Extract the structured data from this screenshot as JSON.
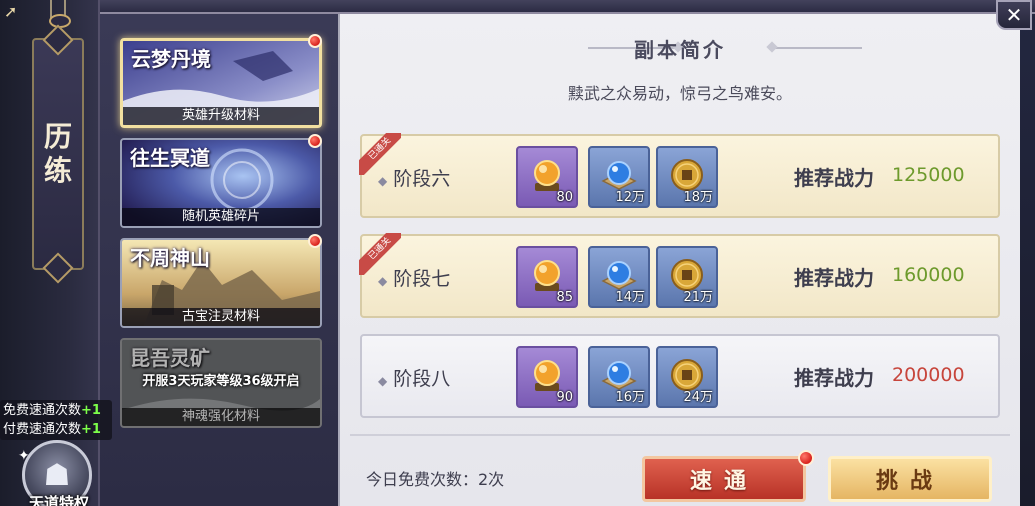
{
  "sidebar": {
    "title_chars": [
      "历",
      "练"
    ],
    "speed_info": {
      "free_label": "免费速通次数",
      "free_value": "+1",
      "paid_label": "付费速通次数",
      "paid_value": "+1"
    },
    "avatar_label": "天道特权"
  },
  "categories": [
    {
      "name": "云梦丹境",
      "subtitle": "英雄升级材料",
      "active": true,
      "has_dot": true
    },
    {
      "name": "往生冥道",
      "subtitle": "随机英雄碎片",
      "active": false,
      "has_dot": true
    },
    {
      "name": "不周神山",
      "subtitle": "古宝注灵材料",
      "active": false,
      "has_dot": true
    },
    {
      "name": "昆吾灵矿",
      "subtitle": "神魂强化材料",
      "lock_text": "开服3天玩家等级36级开启",
      "locked": true
    }
  ],
  "detail": {
    "title": "副本简介",
    "description": "黩武之众易动，惊弓之鸟难安。",
    "cleared_tag": "已通关",
    "power_label": "推荐战力",
    "stages": [
      {
        "name": "阶段六",
        "cleared": true,
        "rewards": [
          {
            "icon": "golden-orb-icon",
            "count": "80"
          },
          {
            "icon": "blue-pearl-icon",
            "count": "12万"
          },
          {
            "icon": "gold-coin-icon",
            "count": "18万"
          }
        ],
        "power": "125000",
        "power_status": "ok"
      },
      {
        "name": "阶段七",
        "cleared": true,
        "rewards": [
          {
            "icon": "golden-orb-icon",
            "count": "85"
          },
          {
            "icon": "blue-pearl-icon",
            "count": "14万"
          },
          {
            "icon": "gold-coin-icon",
            "count": "21万"
          }
        ],
        "power": "160000",
        "power_status": "ok"
      },
      {
        "name": "阶段八",
        "cleared": false,
        "rewards": [
          {
            "icon": "golden-orb-icon",
            "count": "90"
          },
          {
            "icon": "blue-pearl-icon",
            "count": "16万"
          },
          {
            "icon": "gold-coin-icon",
            "count": "24万"
          }
        ],
        "power": "200000",
        "power_status": "hard"
      }
    ],
    "free_count_label": "今日免费次数：2次",
    "sweep_label": "速通",
    "challenge_label": "挑战"
  },
  "colors": {
    "power_ok": "#6d9a2c",
    "power_hard": "#c7453b",
    "sweep_button": "#c83c30",
    "challenge_button": "#f0c879"
  }
}
